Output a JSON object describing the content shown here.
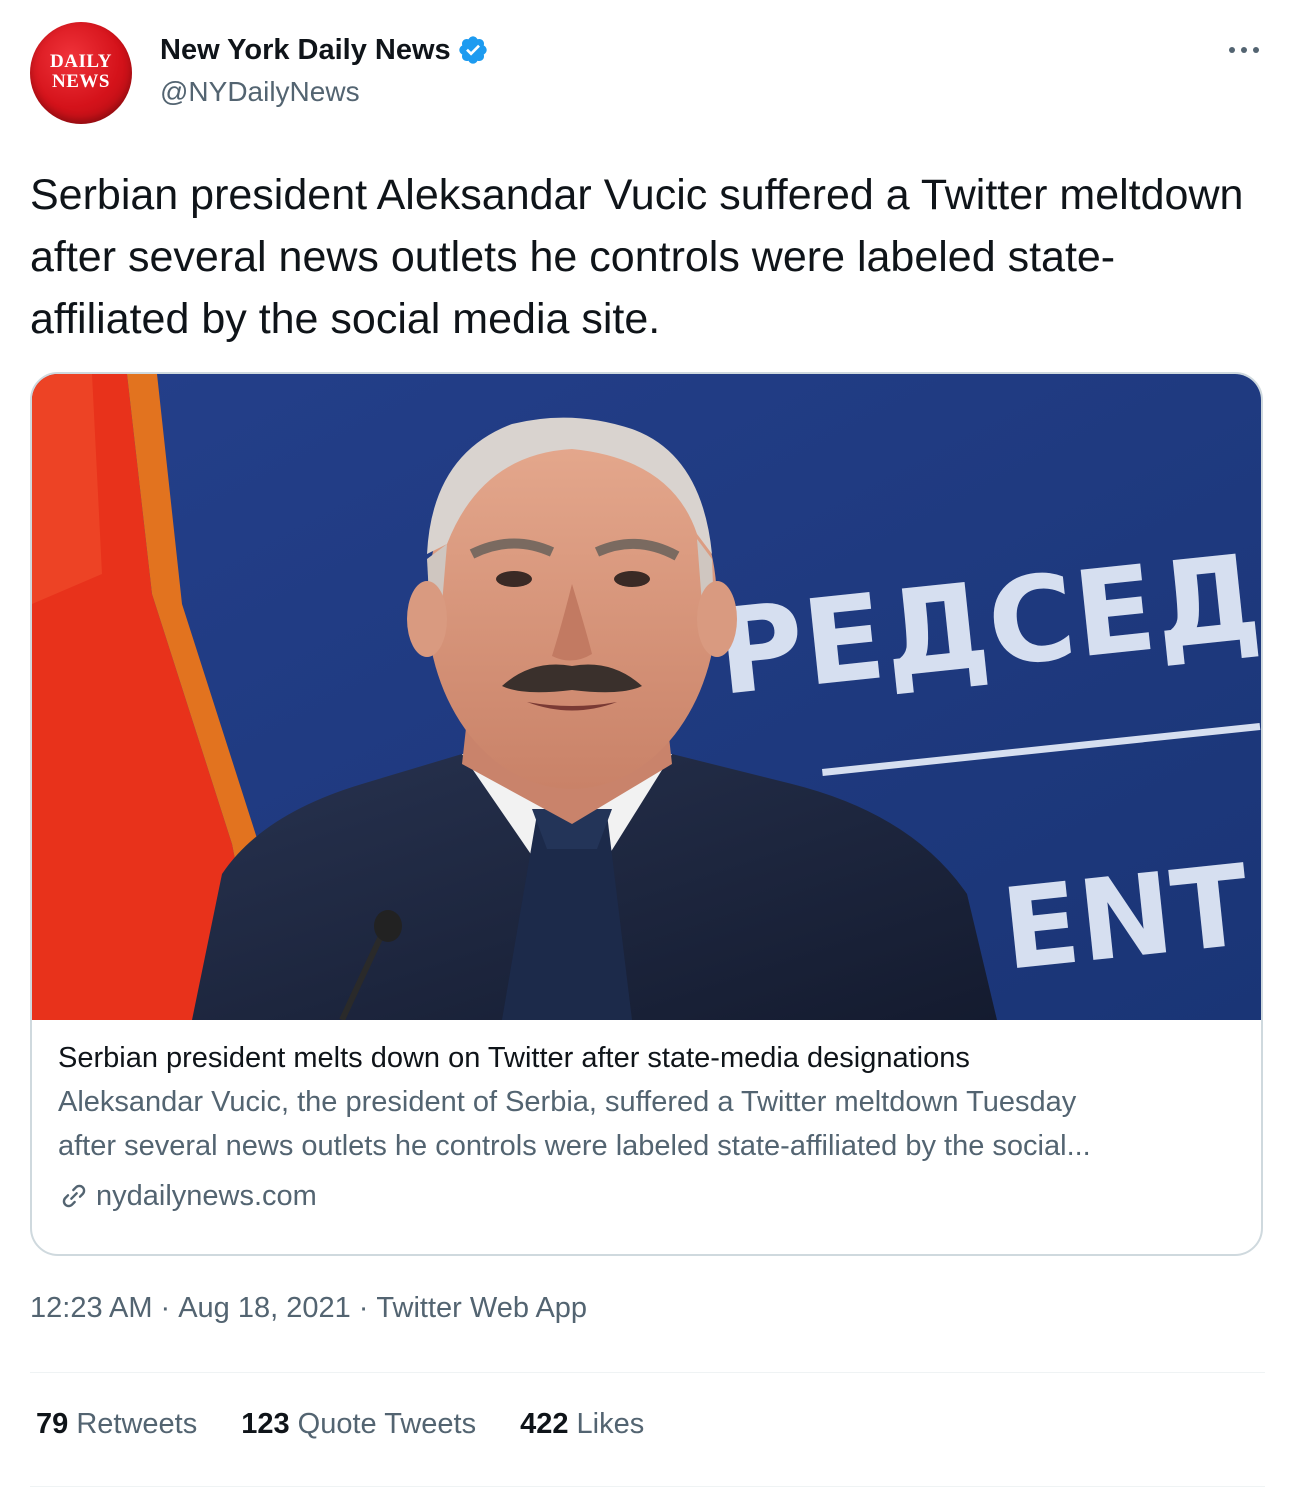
{
  "header": {
    "avatar_logo_line1": "DAILY",
    "avatar_logo_line2": "NEWS",
    "display_name": "New York Daily News",
    "handle": "@NYDailyNews",
    "verified_icon": "verified-badge-icon",
    "more_icon": "more-horizontal-icon"
  },
  "tweet": {
    "text": "Serbian president Aleksandar Vucic suffered a Twitter meltdown after several news outlets he controls were labeled state-affiliated by the social media site."
  },
  "card": {
    "image_sign_text_1": "РЕДСЕД",
    "image_sign_text_2": "ENT",
    "title": "Serbian president melts down on Twitter after state-media designations",
    "description_line1": "Aleksandar Vucic, the president of Serbia, suffered a Twitter meltdown Tuesday",
    "description_line2": "after several news outlets he controls were labeled state-affiliated by the social...",
    "domain": "nydailynews.com",
    "link_icon": "link-icon"
  },
  "meta": {
    "time": "12:23 AM",
    "date": "Aug 18, 2021",
    "source": "Twitter Web App",
    "separator": "·"
  },
  "stats": {
    "retweets_count": "79",
    "retweets_label": "Retweets",
    "quotes_count": "123",
    "quotes_label": "Quote Tweets",
    "likes_count": "422",
    "likes_label": "Likes"
  },
  "colors": {
    "brand_red": "#d4121a",
    "verified_blue": "#1d9bf0",
    "secondary_text": "#536471",
    "backdrop_blue": "#1f3f8c"
  }
}
